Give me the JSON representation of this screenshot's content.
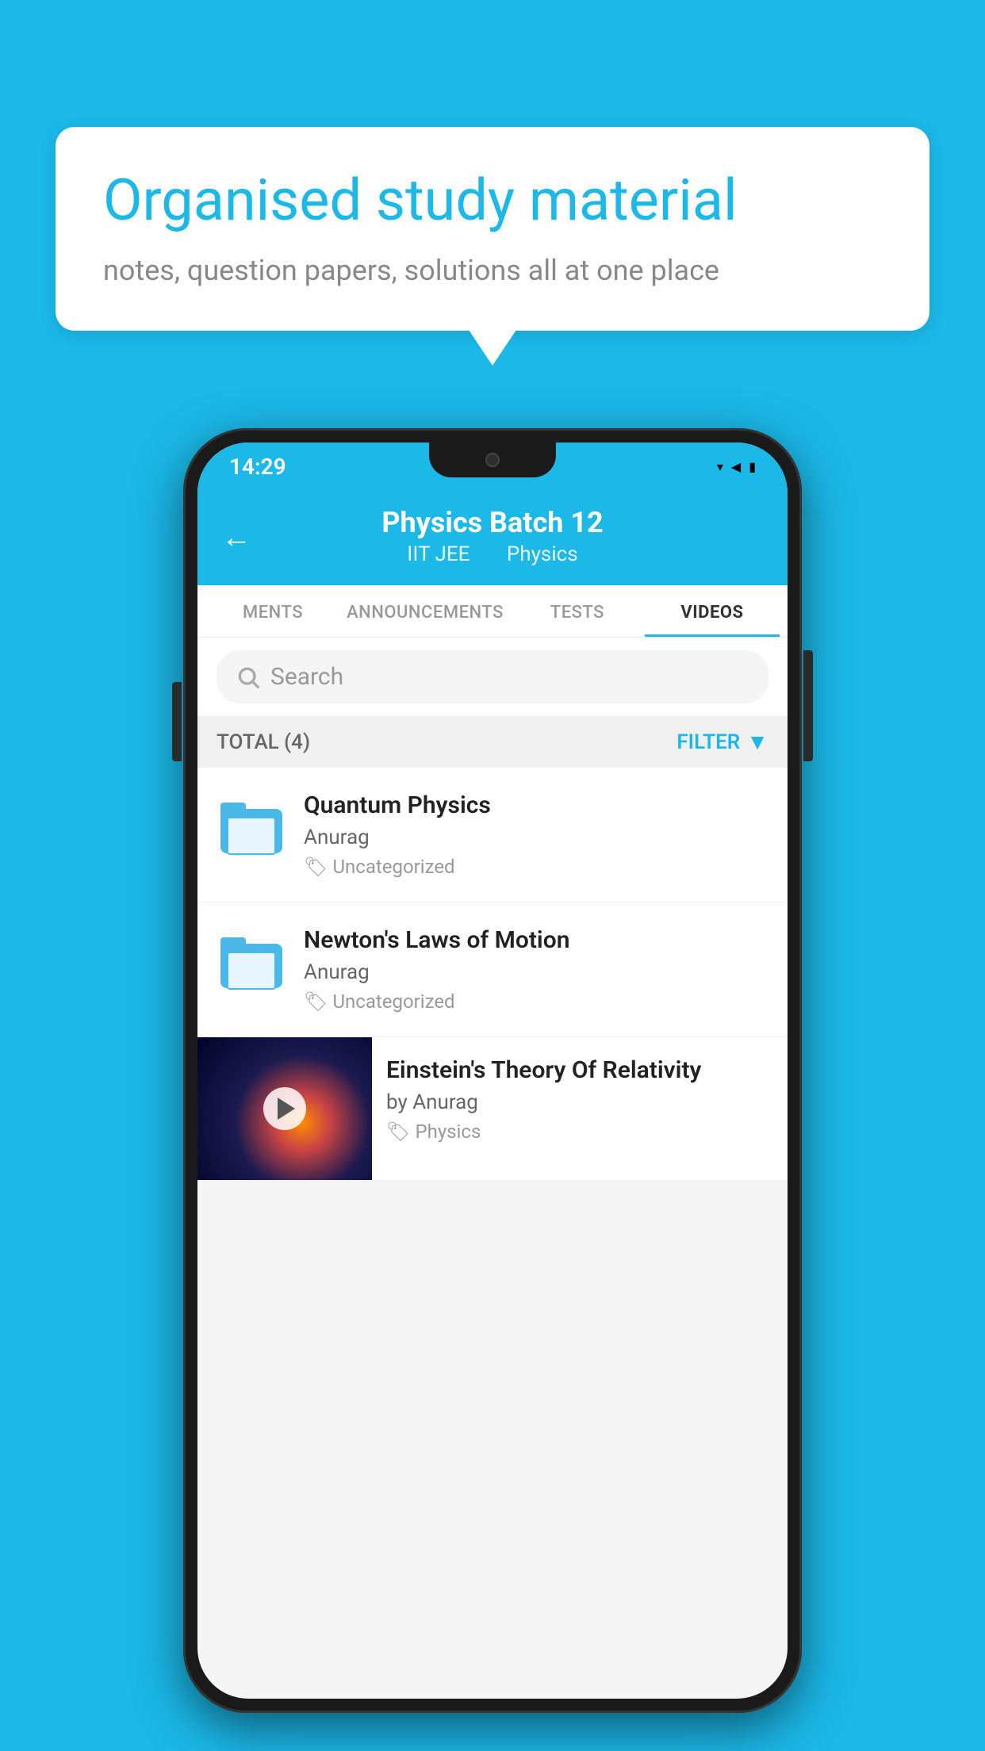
{
  "background": {
    "color": "#1BB8E8"
  },
  "speech_bubble": {
    "title": "Organised study material",
    "subtitle": "notes, question papers, solutions all at one place"
  },
  "phone": {
    "status_bar": {
      "time": "14:29",
      "icons": [
        "wifi",
        "signal",
        "battery"
      ]
    },
    "header": {
      "back_label": "←",
      "title": "Physics Batch 12",
      "subtitle_part1": "IIT JEE",
      "subtitle_part2": "Physics"
    },
    "tabs": [
      {
        "label": "MENTS",
        "active": false
      },
      {
        "label": "ANNOUNCEMENTS",
        "active": false
      },
      {
        "label": "TESTS",
        "active": false
      },
      {
        "label": "VIDEOS",
        "active": true
      }
    ],
    "search": {
      "placeholder": "Search"
    },
    "filter": {
      "total_label": "TOTAL (4)",
      "filter_label": "FILTER"
    },
    "videos": [
      {
        "id": 1,
        "title": "Quantum Physics",
        "author": "Anurag",
        "tag": "Uncategorized",
        "type": "folder",
        "has_thumbnail": false
      },
      {
        "id": 2,
        "title": "Newton's Laws of Motion",
        "author": "Anurag",
        "tag": "Uncategorized",
        "type": "folder",
        "has_thumbnail": false
      },
      {
        "id": 3,
        "title": "Einstein's Theory Of Relativity",
        "author": "by Anurag",
        "tag": "Physics",
        "type": "video",
        "has_thumbnail": true
      }
    ]
  }
}
